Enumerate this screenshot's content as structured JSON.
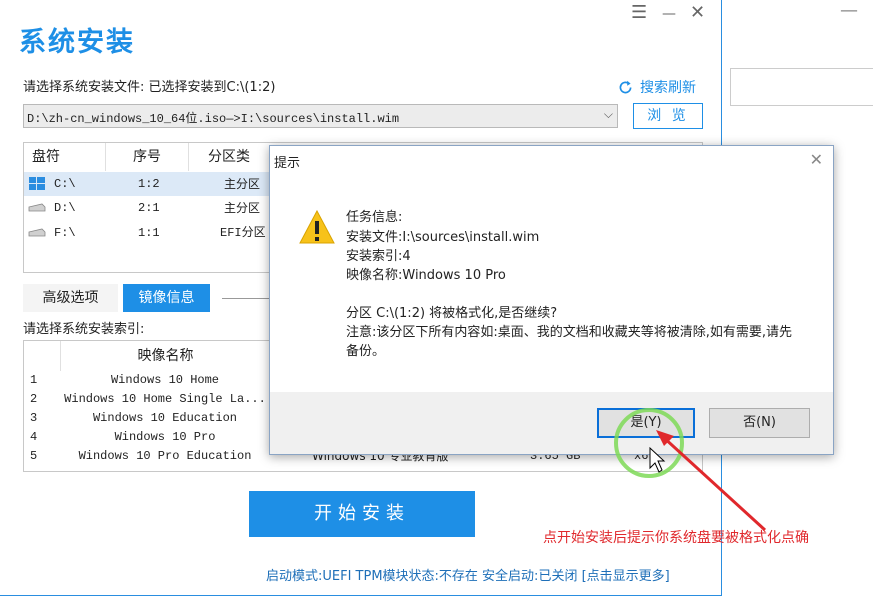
{
  "window": {
    "title": "系统安装",
    "menu_glyph": "☰",
    "min_glyph": "—",
    "close_glyph": "✕"
  },
  "source": {
    "label": "请选择系统安装文件: 已选择安装到C:\\(1:2)",
    "path_value": "D:\\zh-cn_windows_10_64位.iso—>I:\\sources\\install.wim",
    "refresh_label": "搜索刷新",
    "browse_label": "浏 览"
  },
  "partitions": {
    "headers": [
      "盘符",
      "序号",
      "分区类"
    ],
    "rows": [
      {
        "drive": "C:\\",
        "index": "1:2",
        "type": "主分区"
      },
      {
        "drive": "D:\\",
        "index": "2:1",
        "type": "主分区"
      },
      {
        "drive": "F:\\",
        "index": "1:1",
        "type": "EFI分区"
      }
    ]
  },
  "tabs": {
    "advanced": "高级选项",
    "image_info": "镜像信息"
  },
  "images": {
    "label": "请选择系统安装索引:",
    "header_name": "映像名称",
    "rows": [
      {
        "num": "1",
        "name": "Windows 10 Home"
      },
      {
        "num": "2",
        "name": "Windows 10 Home Single La..."
      },
      {
        "num": "3",
        "name": "Windows 10 Education"
      },
      {
        "num": "4",
        "name": "Windows 10 Pro"
      },
      {
        "num": "5",
        "name": "Windows 10 Pro Education",
        "desc": "Windows 10 专业教育版",
        "size": "3.65 GB",
        "arch": "x6"
      }
    ]
  },
  "start_label": "开始安装",
  "status": "启动模式:UEFI  TPM模块状态:不存在  安全启动:已关闭  [点击显示更多]",
  "annotation": "点开始安装后提示你系统盘要被格式化点确",
  "bg_window": {
    "min_glyph": "—"
  },
  "dialog": {
    "title": "提示",
    "close_glyph": "✕",
    "lines": [
      "任务信息:",
      "安装文件:I:\\sources\\install.wim",
      "安装索引:4",
      "映像名称:Windows 10 Pro",
      "分区 C:\\(1:2) 将被格式化,是否继续?",
      "注意:该分区下所有内容如:桌面、我的文档和收藏夹等将被清除,如有需要,请先",
      "备份。"
    ],
    "yes_label": "是(Y)",
    "no_label": "否(N)"
  },
  "colors": {
    "accent": "#1e8fe6",
    "annotation": "#e0282c",
    "highlight_circle": "#7ed957"
  }
}
